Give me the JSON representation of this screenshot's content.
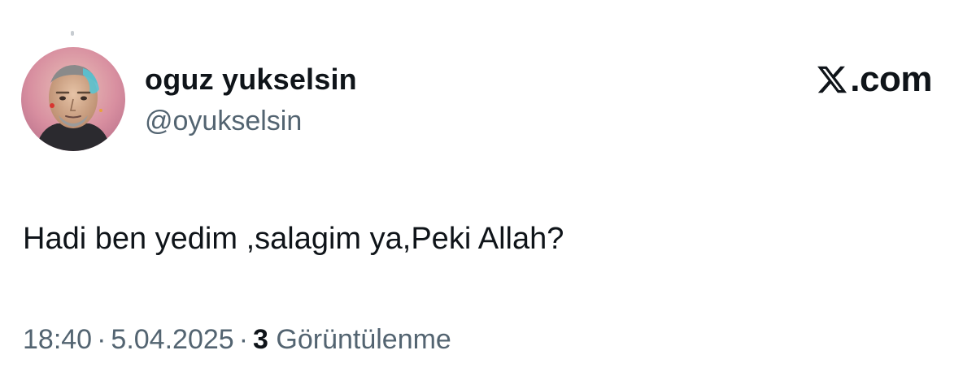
{
  "author": {
    "display_name": "oguz yukselsin",
    "handle": "@oyukselsin",
    "avatar_icon": "avatar-portrait-icon"
  },
  "brand": {
    "icon": "x-logo-icon",
    "suffix": ".com"
  },
  "tweet": {
    "text": "Hadi ben yedim ,salagim ya,Peki Allah?"
  },
  "meta": {
    "time": "18:40",
    "separator": "·",
    "date": "5.04.2025",
    "views_count": "3",
    "views_label": "Görüntülenme"
  },
  "colors": {
    "text_primary": "#0f1419",
    "text_secondary": "#536471",
    "background": "#ffffff"
  }
}
